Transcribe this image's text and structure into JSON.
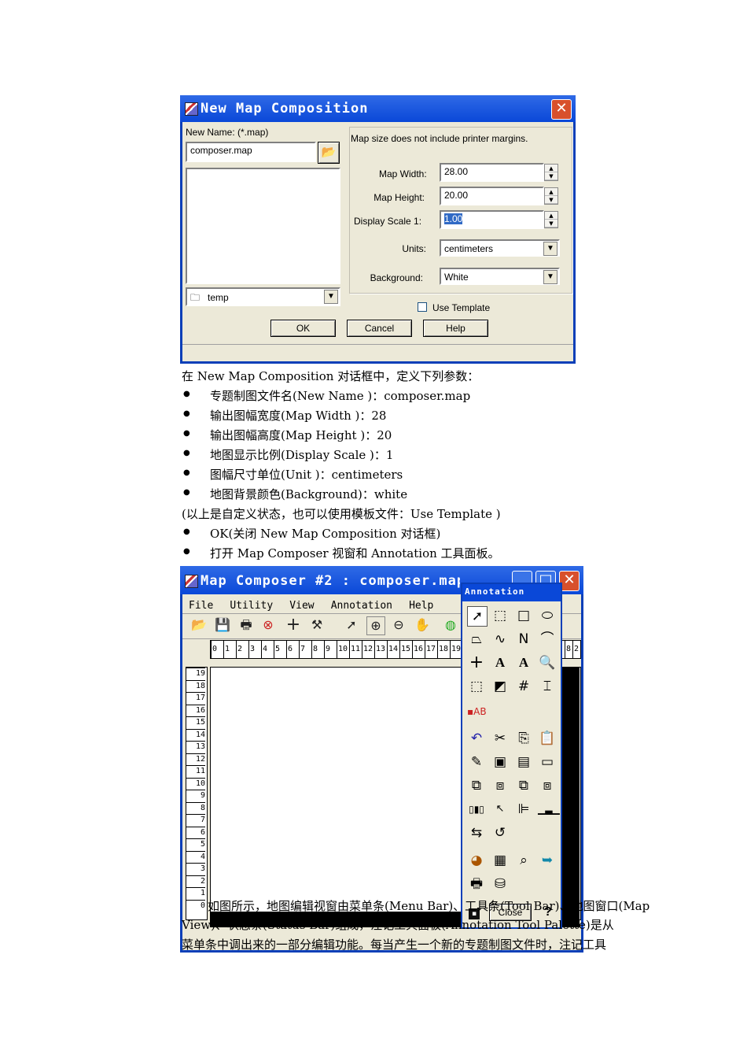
{
  "dialog1": {
    "title": "New Map Composition",
    "new_name_label": "New Name: (*.map)",
    "filename": "composer.map",
    "folder": "temp",
    "info_text": "Map size does not include printer margins.",
    "map_width_label": "Map Width:",
    "map_width": "28.00",
    "map_height_label": "Map Height:",
    "map_height": "20.00",
    "display_scale_label": "Display Scale 1:",
    "display_scale": "1.00",
    "units_label": "Units:",
    "units": "centimeters",
    "background_label": "Background:",
    "background": "White",
    "use_template_label": "Use Template",
    "ok": "OK",
    "cancel": "Cancel",
    "help": "Help"
  },
  "text": {
    "intro": "在 New Map Composition 对话框中，定义下列参数：",
    "bullets": [
      "专题制图文件名(New Name )：composer.map",
      "输出图幅宽度(Map Width )：28",
      "输出图幅高度(Map Height )：20",
      "地图显示比例(Display Scale )：1",
      "图幅尺寸单位(Unit )：centimeters",
      "地图背景颜色(Background)：white"
    ],
    "note": "(以上是自定义状态，也可以使用模板文件：Use Template )",
    "bullets2": [
      "OK(关闭 New Map Composition 对话框)",
      "打开 Map Composer 视窗和 Annotation 工具面板。"
    ],
    "bottom1": "如图所示，地图编辑视窗由菜单条(Menu Bar)、工具条(Tool Bar)、地图窗口(Map",
    "bottom2": "View)、状态条(Status Bar)组成，注记工具面板(Annotation Tool Palette)是从",
    "bottom3": "菜单条中调出来的一部分编辑功能。每当产生一个新的专题制图文件时，注记工具"
  },
  "dialog2": {
    "title": "Map Composer #2 : composer.map",
    "menu": [
      "File",
      "Utility",
      "View",
      "Annotation",
      "Help"
    ],
    "ruler_h": [
      "0",
      "1",
      "2",
      "3",
      "4",
      "5",
      "6",
      "7",
      "8",
      "9",
      "10",
      "11",
      "12",
      "13",
      "14",
      "15",
      "16",
      "17",
      "18",
      "19",
      "2"
    ],
    "ruler_h_end": [
      "8",
      "2"
    ],
    "ruler_v": [
      "19",
      "18",
      "17",
      "16",
      "15",
      "14",
      "13",
      "12",
      "11",
      "10",
      "9",
      "8",
      "7",
      "6",
      "5",
      "4",
      "3",
      "2",
      "1",
      "0"
    ]
  },
  "palette": {
    "title": "Annotation",
    "close": "Close",
    "help": "?"
  }
}
